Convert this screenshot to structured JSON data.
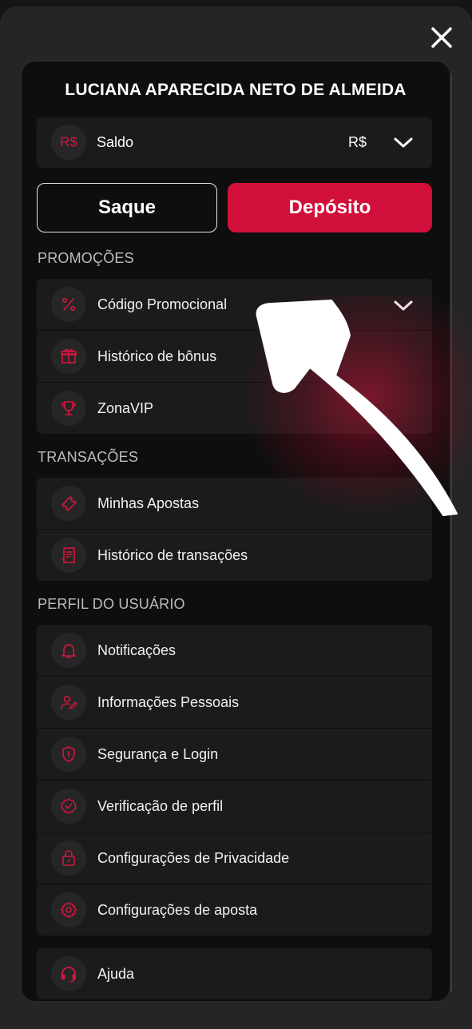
{
  "user": {
    "name": "LUCIANA APARECIDA NETO DE ALMEIDA"
  },
  "balance": {
    "icon_text": "R$",
    "label": "Saldo",
    "currency": "R$"
  },
  "actions": {
    "withdraw_label": "Saque",
    "deposit_label": "Depósito"
  },
  "sections": {
    "promotions": {
      "title": "PROMOÇÕES",
      "items": [
        {
          "label": "Código Promocional",
          "icon": "percent-icon"
        },
        {
          "label": "Histórico de bônus",
          "icon": "gift-icon"
        },
        {
          "label": "ZonaVIP",
          "icon": "trophy-icon"
        }
      ]
    },
    "transactions": {
      "title": "TRANSAÇÕES",
      "items": [
        {
          "label": "Minhas Apostas",
          "icon": "ticket-icon"
        },
        {
          "label": "Histórico de transações",
          "icon": "receipt-icon"
        }
      ]
    },
    "profile": {
      "title": "PERFIL DO USUÁRIO",
      "items": [
        {
          "label": "Notificações",
          "icon": "bell-icon"
        },
        {
          "label": "Informações Pessoais",
          "icon": "user-edit-icon"
        },
        {
          "label": "Segurança e Login",
          "icon": "shield-icon"
        },
        {
          "label": "Verificação de perfil",
          "icon": "verified-badge-icon"
        },
        {
          "label": "Configurações de Privacidade",
          "icon": "lock-icon"
        },
        {
          "label": "Configurações de aposta",
          "icon": "gear-icon"
        }
      ]
    },
    "help": {
      "items": [
        {
          "label": "Ajuda",
          "icon": "headset-icon"
        }
      ]
    }
  },
  "colors": {
    "accent": "#d0103a",
    "panel": "#0e0e0e",
    "card": "#1b1b1b",
    "backdrop": "#252525"
  }
}
